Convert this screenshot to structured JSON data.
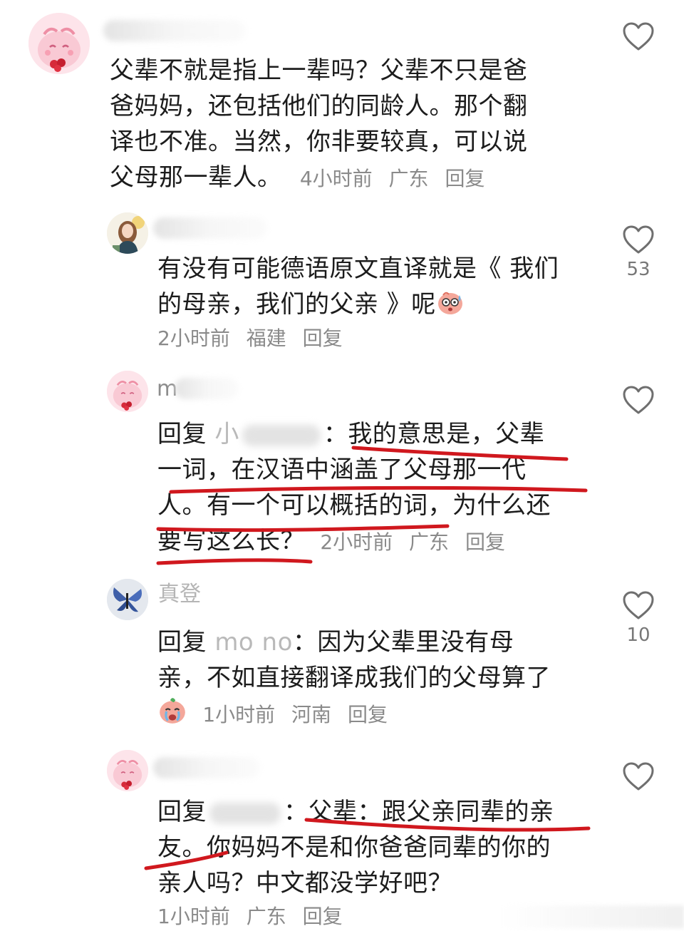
{
  "comments": [
    {
      "id": "c1",
      "name_visible": "",
      "text_lines": [
        "父辈不就是指上一辈吗？父辈不只是爸",
        "爸妈妈，还包括他们的同龄人。那个翻",
        "译也不准。当然，你非要较真，可以说"
      ],
      "last_line_text": "父母那一辈人。",
      "time": "4小时前",
      "location": "广东",
      "reply_label": "回复",
      "likes": ""
    },
    {
      "id": "c2",
      "name_visible": "",
      "text_lines": [
        "有没有可能德语原文直译就是《 我们"
      ],
      "last_line_text": "的母亲，我们的父亲 》呢",
      "time": "2小时前",
      "location": "福建",
      "reply_label": "回复",
      "likes": "53"
    },
    {
      "id": "c3",
      "name_visible": "m",
      "reply_prefix": "回复",
      "reply_target_fragment": "小",
      "colon": "：",
      "text_first": "我的意思是，父辈",
      "text_lines": [
        "一词，在汉语中涵盖了父母那一代",
        "人。有一个可以概括的词，为什么还"
      ],
      "last_line_text": "要写这么长？",
      "time": "2小时前",
      "location": "广东",
      "reply_label": "回复",
      "likes": ""
    },
    {
      "id": "c4",
      "name_visible": "真登",
      "reply_prefix": "回复",
      "reply_target_fragment": "mo  no",
      "colon": "：",
      "text_first": "因为父辈里没有母",
      "text_lines": [
        "亲，不如直接翻译成我们的父母算了"
      ],
      "time": "1小时前",
      "location": "河南",
      "reply_label": "回复",
      "likes": "10"
    },
    {
      "id": "c5",
      "name_visible": "",
      "reply_prefix": "回复",
      "reply_target_fragment": "",
      "colon": "：",
      "text_first": "父辈：跟父亲同辈的亲",
      "text_lines": [
        "友。你妈妈不是和你爸爸同辈的你的",
        "亲人吗？中文都没学好吧？"
      ],
      "time": "1小时前",
      "location": "广东",
      "reply_label": "回复",
      "likes": ""
    }
  ],
  "colors": {
    "underline": "#d0181e",
    "heart_stroke": "#6f6f6f",
    "meta_text": "#8a8a8a"
  },
  "icons": {
    "like": "heart-outline-icon",
    "emoji_c2": "shocked-face-emoji",
    "emoji_c4": "crying-face-emoji"
  }
}
